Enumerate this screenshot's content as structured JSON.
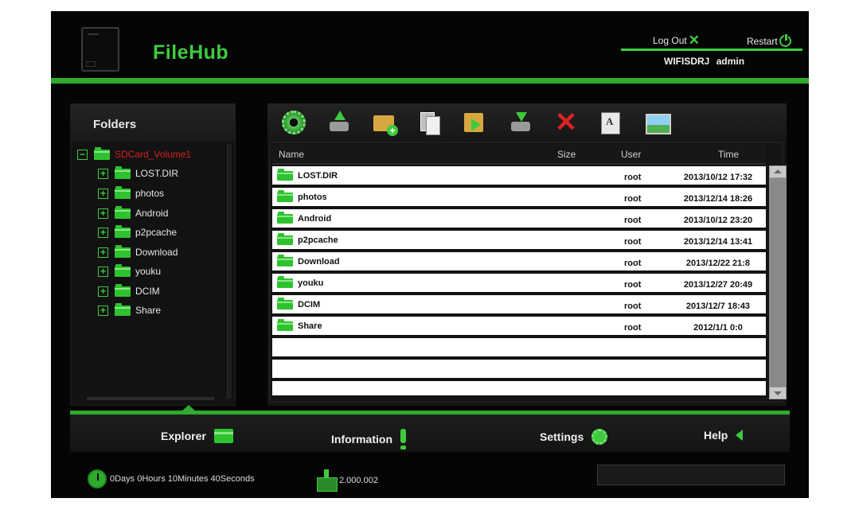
{
  "app": {
    "title": "FileHub"
  },
  "header": {
    "logout_label": "Log Out",
    "restart_label": "Restart",
    "device_name": "WIFISDRJ",
    "username": "admin"
  },
  "folders": {
    "title": "Folders",
    "root": "SDCard_Volume1",
    "items": [
      "LOST.DIR",
      "photos",
      "Android",
      "p2pcache",
      "Download",
      "youku",
      "DCIM",
      "Share"
    ]
  },
  "toolbar": {
    "icons": [
      "gear-icon",
      "upload-icon",
      "new-folder-icon",
      "copy-icon",
      "move-icon",
      "download-icon",
      "delete-icon",
      "rename-icon",
      "image-icon"
    ]
  },
  "file_list": {
    "columns": {
      "name": "Name",
      "size": "Size",
      "user": "User",
      "time": "Time"
    },
    "rows": [
      {
        "name": "LOST.DIR",
        "size": "",
        "user": "root",
        "time": "2013/10/12 17:32"
      },
      {
        "name": "photos",
        "size": "",
        "user": "root",
        "time": "2013/12/14 18:26"
      },
      {
        "name": "Android",
        "size": "",
        "user": "root",
        "time": "2013/10/12 23:20"
      },
      {
        "name": "p2pcache",
        "size": "",
        "user": "root",
        "time": "2013/12/14 13:41"
      },
      {
        "name": "Download",
        "size": "",
        "user": "root",
        "time": "2013/12/22 21:8"
      },
      {
        "name": "youku",
        "size": "",
        "user": "root",
        "time": "2013/12/27 20:49"
      },
      {
        "name": "DCIM",
        "size": "",
        "user": "root",
        "time": "2013/12/7 18:43"
      },
      {
        "name": "Share",
        "size": "",
        "user": "root",
        "time": "2012/1/1 0:0"
      }
    ]
  },
  "nav": {
    "explorer": "Explorer",
    "information": "Information",
    "settings": "Settings",
    "help": "Help",
    "active": "explorer"
  },
  "status": {
    "uptime": "0Days 0Hours 10Minutes 40Seconds",
    "version": "2.000.002"
  },
  "colors": {
    "accent": "#3ecb3e",
    "background": "#050505",
    "root_folder_label": "#d52020",
    "delete": "#e02222"
  }
}
